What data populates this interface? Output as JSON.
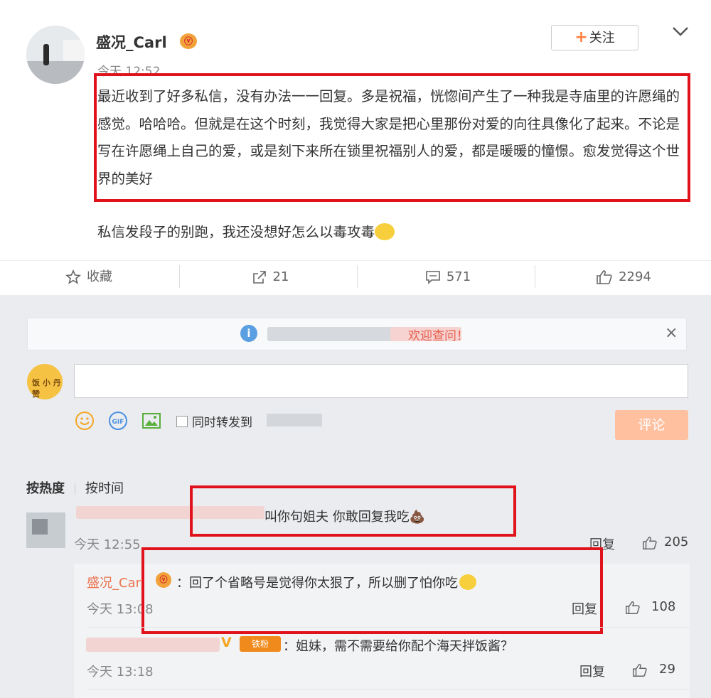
{
  "post": {
    "username": "盛况_Carl",
    "vip_badge": "ⓥ",
    "time": "今天 12:52",
    "follow_label": "关注",
    "follow_plus": "+",
    "content": "最近收到了好多私信，没有办法一一回复。多是祝福，恍惚间产生了一种我是寺庙里的许愿绳的感觉。哈哈哈。但就是在这个时刻，我觉得大家是把心里那份对爱的向往具像化了起来。不论是写在许愿绳上自己的爱，或是刻下来所在锁里祝福别人的爱，都是暖暖的憧憬。愈发觉得这个世界的美好",
    "content_extra": "私信发段子的别跑，我还没想好怎么以毒攻毒"
  },
  "actions": {
    "favorite": "收藏",
    "repost": "21",
    "comment": "571",
    "like": "2294"
  },
  "notice": {
    "text": "欢迎查问！",
    "close": "×"
  },
  "composer": {
    "avatar_text": "饭 小 丹 赞",
    "repost_label": "同时转发到",
    "submit_label": "评论"
  },
  "sort": {
    "hot": "按热度",
    "time": "按时间"
  },
  "comments": [
    {
      "text": "叫你句姐夫 你敢回复我吃💩",
      "time": "今天 12:55",
      "reply_label": "回复",
      "likes": "205",
      "replies": [
        {
          "name": "盛况_Carl",
          "text": "：回了个省略号是觉得你太狠了，所以删了怕你吃",
          "time": "今天 13:08",
          "reply_label": "回复",
          "likes": "108"
        },
        {
          "badge": "铁粉",
          "text": "：姐妹，需不需要给你配个海天拌饭酱？",
          "time": "今天 13:18",
          "reply_label": "回复",
          "likes": "29"
        }
      ]
    }
  ],
  "colors": {
    "highlight_box": "#e0121b",
    "accent_orange": "#ff8140",
    "name_link": "#eb7350",
    "submit_bg": "#ffc09f"
  }
}
